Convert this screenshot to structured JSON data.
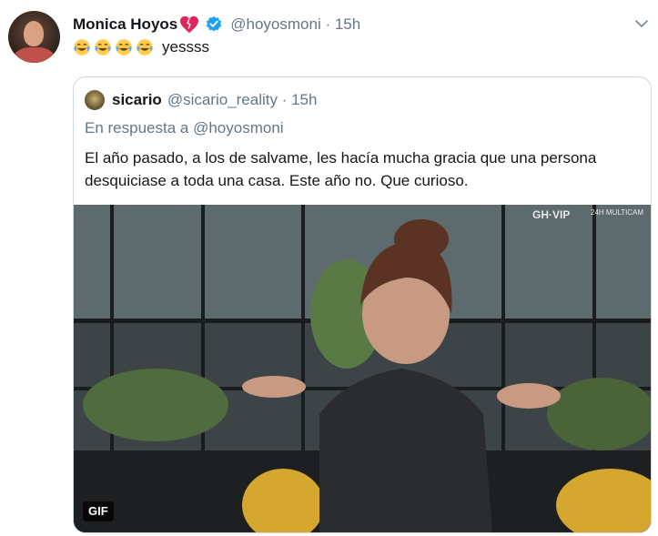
{
  "tweet": {
    "author_name": "Monica Hoyos",
    "author_handle": "@hoyosmoni · 15h",
    "text": "yessss",
    "emoji_count": 4,
    "emoji_icon": "face-with-tears-of-joy-icon"
  },
  "quoted": {
    "author_name": "sicario",
    "author_handle": "@sicario_reality · 15h",
    "reply_prefix": "En respuesta a",
    "reply_to": "@hoyosmoni",
    "text": "El año pasado, a los de salvame,  les hacía mucha gracia que una persona desquiciase a toda una casa. Este año no. Que curioso.",
    "media_badge": "GIF",
    "media_watermark": "GH·VIP",
    "media_watermark_sub": "24H MULTICAM"
  },
  "colors": {
    "secondary_text": "#657786",
    "verified_blue": "#1da1f2",
    "border": "#ccd6dd"
  }
}
